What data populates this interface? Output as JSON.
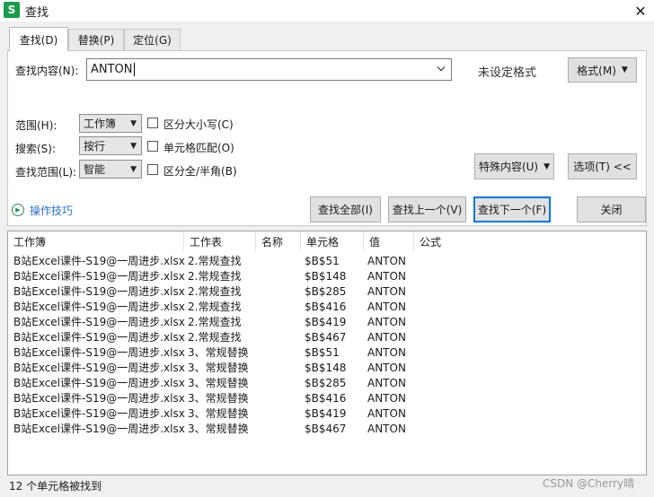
{
  "window": {
    "app_badge": "S",
    "title": "查找",
    "close_glyph": "✕"
  },
  "tabs": [
    {
      "label": "查找(D)",
      "active": true
    },
    {
      "label": "替换(P)",
      "active": false
    },
    {
      "label": "定位(G)",
      "active": false
    }
  ],
  "find": {
    "label": "查找内容(N):",
    "value": "ANTON",
    "format_status": "未设定格式",
    "format_button": "格式(M)"
  },
  "options": {
    "scope_label": "范围(H):",
    "scope_value": "工作簿",
    "search_label": "搜索(S):",
    "search_value": "按行",
    "lookin_label": "查找范围(L):",
    "lookin_value": "智能",
    "match_case": "区分大小写(C)",
    "match_cell": "单元格匹配(O)",
    "match_width": "区分全/半角(B)",
    "special_button": "特殊内容(U)",
    "options_button": "选项(T) <<"
  },
  "actions": {
    "tips": "操作技巧",
    "find_all": "查找全部(I)",
    "find_prev": "查找上一个(V)",
    "find_next": "查找下一个(F)",
    "close": "关闭"
  },
  "results": {
    "columns": [
      "工作簿",
      "工作表",
      "名称",
      "单元格",
      "值",
      "公式"
    ],
    "rows": [
      [
        "B站Excel课件-S19@一周进步.xlsx",
        "2.常规查找",
        "",
        "$B$51",
        "ANTON",
        ""
      ],
      [
        "B站Excel课件-S19@一周进步.xlsx",
        "2.常规查找",
        "",
        "$B$148",
        "ANTON",
        ""
      ],
      [
        "B站Excel课件-S19@一周进步.xlsx",
        "2.常规查找",
        "",
        "$B$285",
        "ANTON",
        ""
      ],
      [
        "B站Excel课件-S19@一周进步.xlsx",
        "2.常规查找",
        "",
        "$B$416",
        "ANTON",
        ""
      ],
      [
        "B站Excel课件-S19@一周进步.xlsx",
        "2.常规查找",
        "",
        "$B$419",
        "ANTON",
        ""
      ],
      [
        "B站Excel课件-S19@一周进步.xlsx",
        "2.常规查找",
        "",
        "$B$467",
        "ANTON",
        ""
      ],
      [
        "B站Excel课件-S19@一周进步.xlsx",
        "3、常规替换",
        "",
        "$B$51",
        "ANTON",
        ""
      ],
      [
        "B站Excel课件-S19@一周进步.xlsx",
        "3、常规替换",
        "",
        "$B$148",
        "ANTON",
        ""
      ],
      [
        "B站Excel课件-S19@一周进步.xlsx",
        "3、常规替换",
        "",
        "$B$285",
        "ANTON",
        ""
      ],
      [
        "B站Excel课件-S19@一周进步.xlsx",
        "3、常规替换",
        "",
        "$B$416",
        "ANTON",
        ""
      ],
      [
        "B站Excel课件-S19@一周进步.xlsx",
        "3、常规替换",
        "",
        "$B$419",
        "ANTON",
        ""
      ],
      [
        "B站Excel课件-S19@一周进步.xlsx",
        "3、常规替换",
        "",
        "$B$467",
        "ANTON",
        ""
      ]
    ]
  },
  "status": "12 个单元格被找到",
  "watermark": "CSDN @Cherry晴"
}
